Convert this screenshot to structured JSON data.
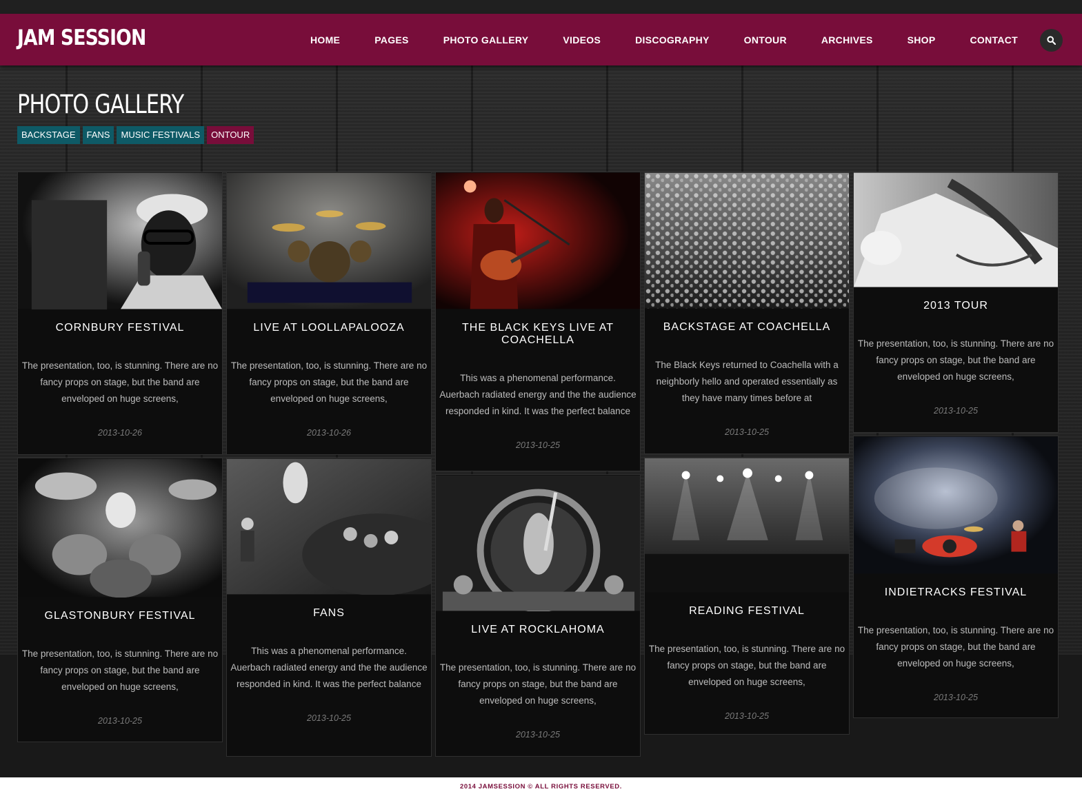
{
  "brand": {
    "logo": "JAM SESSION",
    "accent": "#780d3a",
    "filter_color": "#0e5a66"
  },
  "nav": {
    "items": [
      "HOME",
      "PAGES",
      "PHOTO GALLERY",
      "VIDEOS",
      "DISCOGRAPHY",
      "ONTOUR",
      "ARCHIVES",
      "SHOP",
      "CONTACT"
    ],
    "search_icon": "search-icon"
  },
  "page": {
    "title": "PHOTO GALLERY"
  },
  "filters": [
    {
      "label": "BACKSTAGE",
      "active": false
    },
    {
      "label": "FANS",
      "active": false
    },
    {
      "label": "MUSIC FESTIVALS",
      "active": false
    },
    {
      "label": "ONTOUR",
      "active": true
    }
  ],
  "gallery": [
    {
      "title": "CORNBURY FESTIVAL",
      "excerpt": "The presentation, too, is stunning. There are no fancy props on stage, but the band are enveloped on huge screens,",
      "date": "2013-10-26"
    },
    {
      "title": "LIVE AT LOOLLAPALOOZA",
      "excerpt": "The presentation, too, is stunning. There are no fancy props on stage, but the band are enveloped on huge screens,",
      "date": "2013-10-26"
    },
    {
      "title": "THE BLACK KEYS LIVE AT COACHELLA",
      "excerpt": "This was a phenomenal performance. Auerbach radiated energy and the the audience responded in kind. It was the perfect balance",
      "date": "2013-10-25"
    },
    {
      "title": "BACKSTAGE AT COACHELLA",
      "excerpt": "The Black Keys returned to Coachella with a neighborly hello and operated essentially as they have many times before at",
      "date": "2013-10-25"
    },
    {
      "title": "2013 TOUR",
      "excerpt": "The presentation, too, is stunning. There are no fancy props on stage, but the band are enveloped on huge screens,",
      "date": "2013-10-25"
    },
    {
      "title": "GLASTONBURY FESTIVAL",
      "excerpt": "The presentation, too, is stunning. There are no fancy props on stage, but the band are enveloped on huge screens,",
      "date": "2013-10-25"
    },
    {
      "title": "FANS",
      "excerpt": "This was a phenomenal performance. Auerbach radiated energy and the the audience responded in kind. It was the perfect balance",
      "date": "2013-10-25"
    },
    {
      "title": "LIVE AT ROCKLAHOMA",
      "excerpt": "The presentation, too, is stunning. There are no fancy props on stage, but the band are enveloped on huge screens,",
      "date": "2013-10-25"
    },
    {
      "title": "READING FESTIVAL",
      "excerpt": "The presentation, too, is stunning. There are no fancy props on stage, but the band are enveloped on huge screens,",
      "date": "2013-10-25"
    },
    {
      "title": "INDIETRACKS FESTIVAL",
      "excerpt": "The presentation, too, is stunning. There are no fancy props on stage, but the band are enveloped on huge screens,",
      "date": "2013-10-25"
    }
  ],
  "footer": {
    "text": "2014 JAMSESSION © ALL RIGHTS RESERVED."
  }
}
